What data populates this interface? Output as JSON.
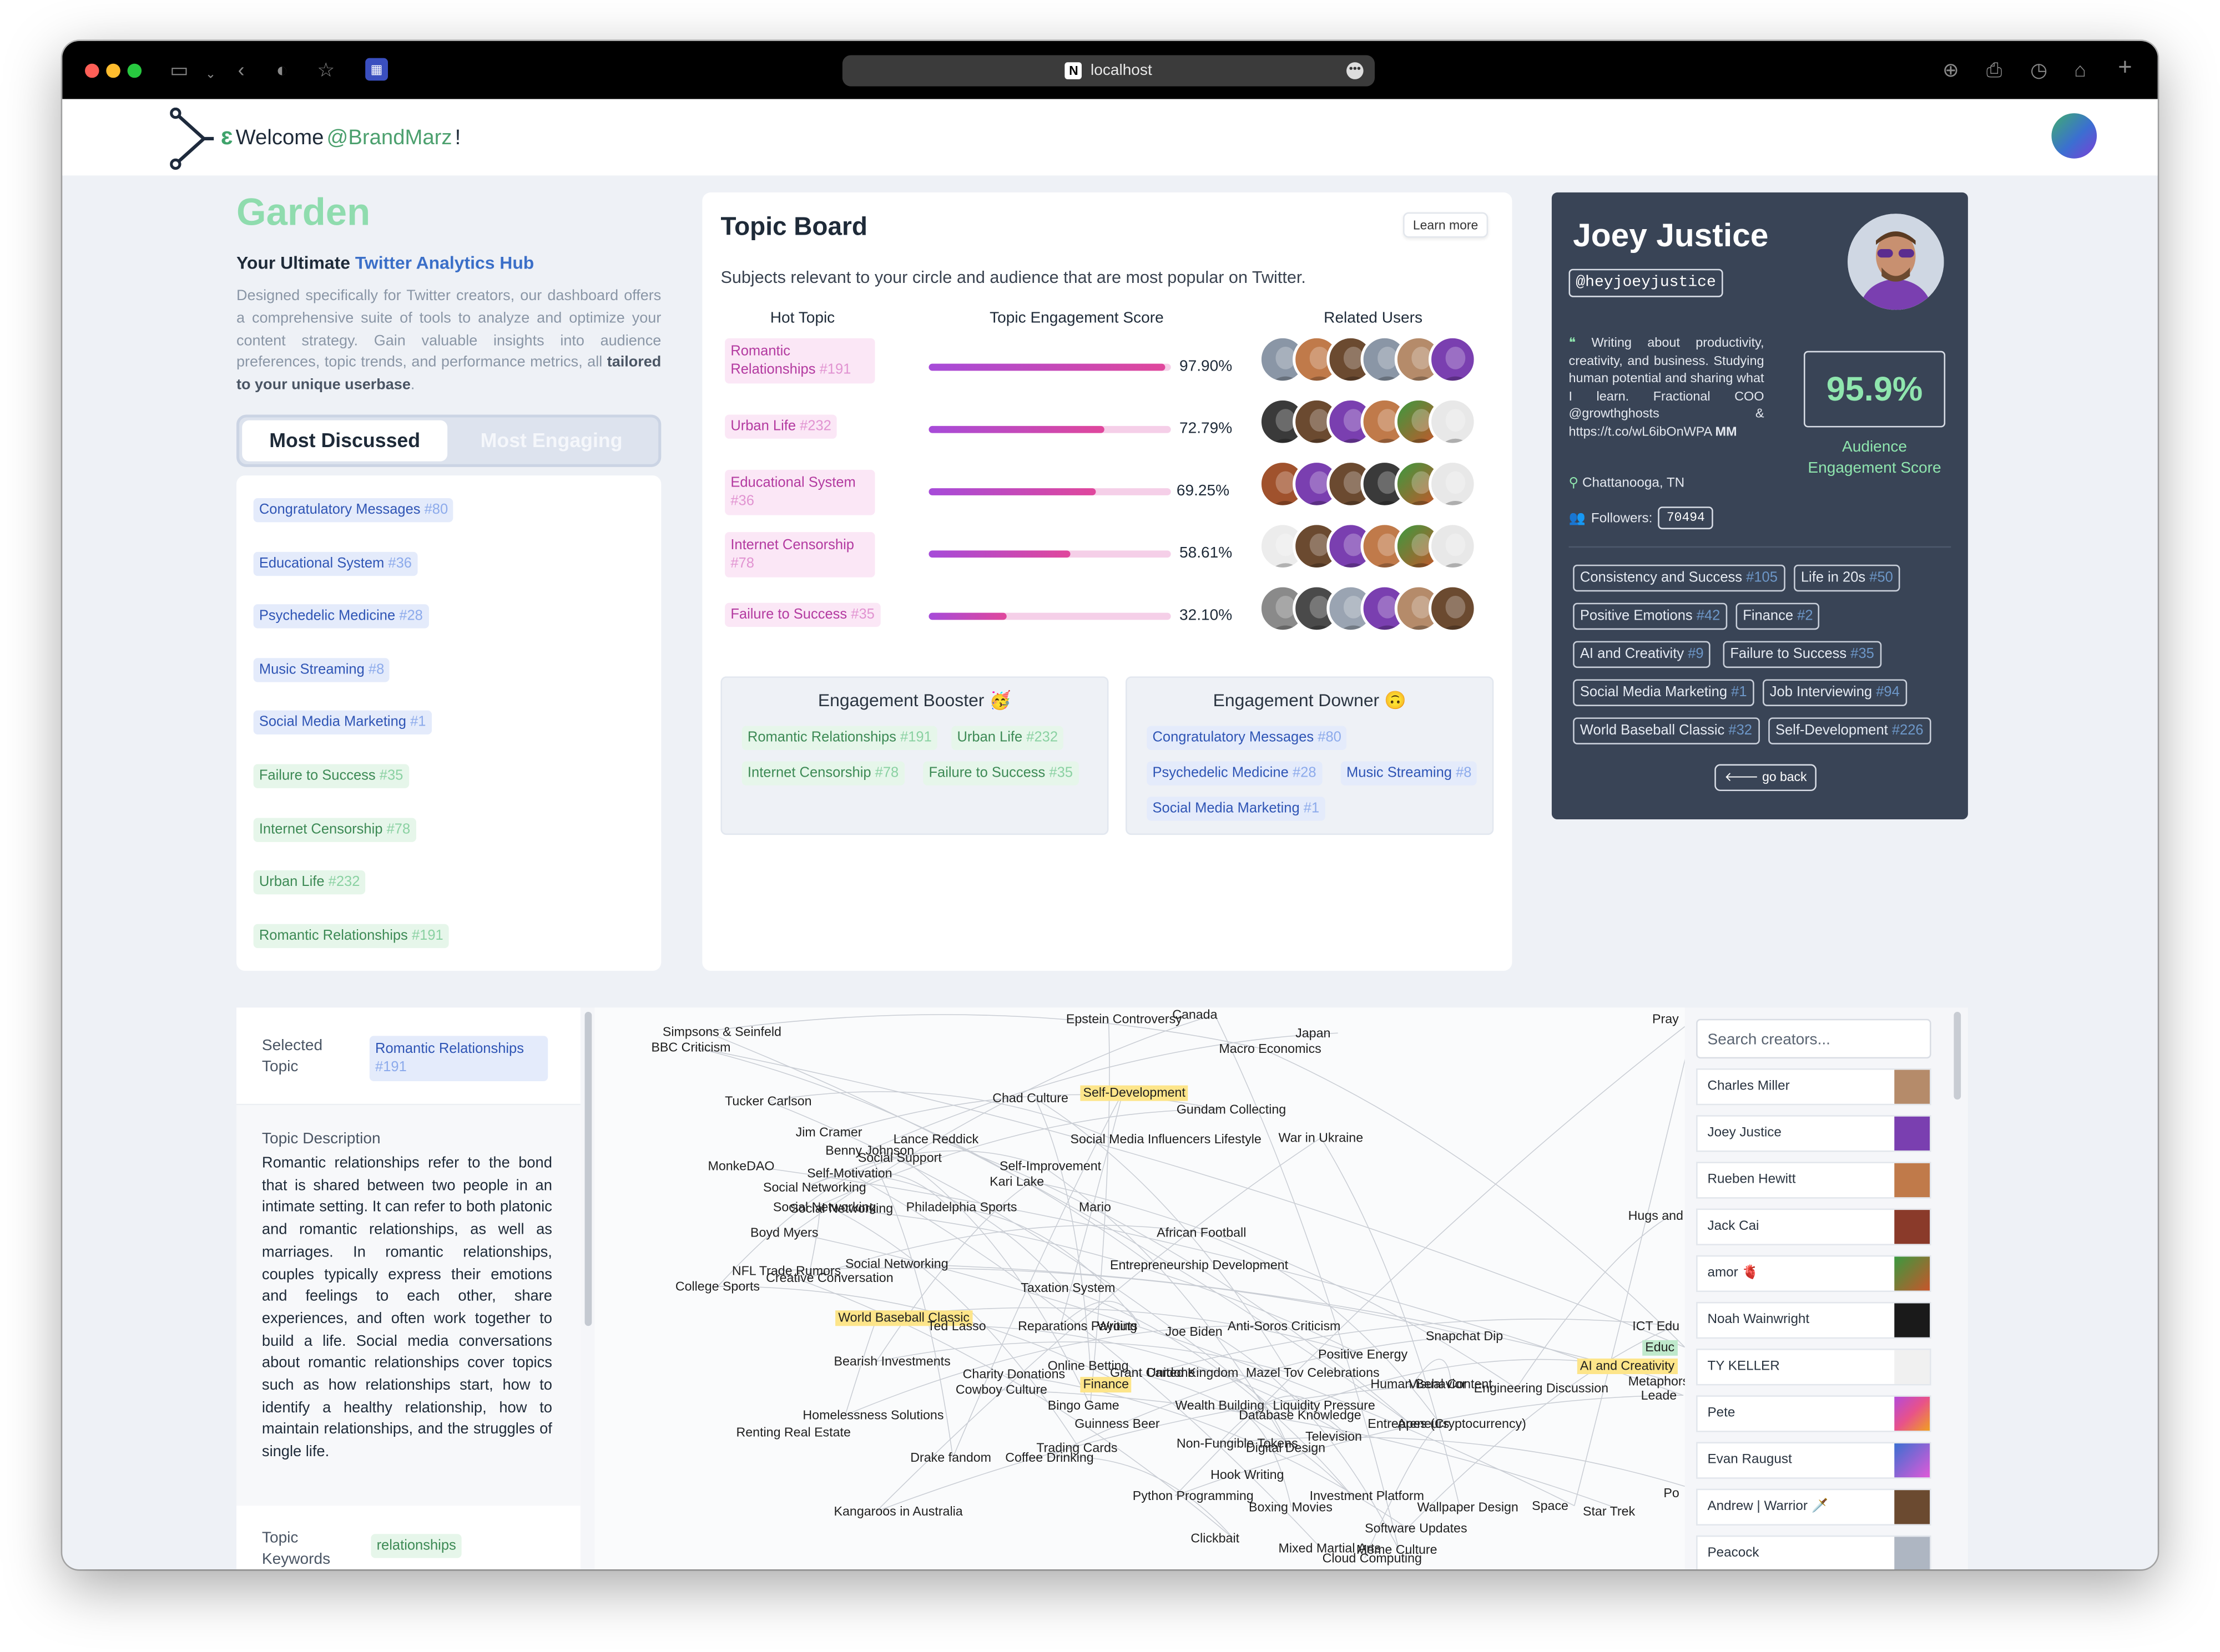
{
  "browser": {
    "url": "localhost"
  },
  "header": {
    "welcome": "Welcome ",
    "username": "@BrandMarz",
    "exclaim": "!"
  },
  "hero": {
    "brand": "Garden",
    "subtitle_prefix": "Your Ultimate ",
    "subtitle_highlight": "Twitter Analytics Hub",
    "description": "Designed specifically for Twitter creators, our dashboard offers a comprehensive suite of tools to analyze and optimize your content strategy. Gain valuable insights into audience preferences, topic trends, and performance metrics, all ",
    "description_bold": "tailored to your unique userbase",
    "description_end": "."
  },
  "tabs": {
    "active": "Most Discussed",
    "inactive": "Most Engaging"
  },
  "discussed": [
    {
      "label": "Congratulatory Messages",
      "num": "#80",
      "color": "blue"
    },
    {
      "label": "Educational System",
      "num": "#36",
      "color": "blue"
    },
    {
      "label": "Psychedelic Medicine",
      "num": "#28",
      "color": "blue"
    },
    {
      "label": "Music Streaming",
      "num": "#8",
      "color": "blue"
    },
    {
      "label": "Social Media Marketing",
      "num": "#1",
      "color": "blue"
    },
    {
      "label": "Failure to Success",
      "num": "#35",
      "color": "green"
    },
    {
      "label": "Internet Censorship",
      "num": "#78",
      "color": "green"
    },
    {
      "label": "Urban Life",
      "num": "#232",
      "color": "green"
    },
    {
      "label": "Romantic Relationships",
      "num": "#191",
      "color": "green"
    }
  ],
  "board": {
    "title": "Topic Board",
    "learn_more": "Learn more",
    "subtitle": "Subjects relevant to your circle and audience that are most popular on Twitter.",
    "col_topic": "Hot Topic",
    "col_score": "Topic Engagement Score",
    "col_users": "Related Users",
    "rows": [
      {
        "label": "Romantic Relationships",
        "num": "#191",
        "score": 0.979,
        "pct": "97.90%"
      },
      {
        "label": "Urban Life",
        "num": "#232",
        "score": 0.7279,
        "pct": "72.79%"
      },
      {
        "label": "Educational System",
        "num": "#36",
        "score": 0.6925,
        "pct": "69.25%"
      },
      {
        "label": "Internet Censorship",
        "num": "#78",
        "score": 0.5861,
        "pct": "58.61%"
      },
      {
        "label": "Failure to Success",
        "num": "#35",
        "score": 0.321,
        "pct": "32.10%"
      }
    ]
  },
  "booster": {
    "title": "Engagement Booster 🥳",
    "items": [
      {
        "label": "Romantic Relationships",
        "num": "#191"
      },
      {
        "label": "Urban Life",
        "num": "#232"
      },
      {
        "label": "Internet Censorship",
        "num": "#78"
      },
      {
        "label": "Failure to Success",
        "num": "#35"
      }
    ]
  },
  "downer": {
    "title": "Engagement Downer 🙃",
    "items": [
      {
        "label": "Congratulatory Messages",
        "num": "#80"
      },
      {
        "label": "Psychedelic Medicine",
        "num": "#28"
      },
      {
        "label": "Music Streaming",
        "num": "#8"
      },
      {
        "label": "Social Media Marketing",
        "num": "#1"
      }
    ]
  },
  "profile": {
    "name": "Joey Justice",
    "handle": "@heyjoeyjustice",
    "bio": "Writing about productivity, creativity, and business. Studying human potential and sharing what I learn. Fractional COO @growthghosts & https://t.co/wL6ibOnWPA ",
    "bio_bold": "MM",
    "location": "Chattanooga, TN",
    "followers_label": "Followers:",
    "followers": "70494",
    "score": "95.9%",
    "score_label": "Audience Engagement Score",
    "go_back": "go back",
    "topics": [
      {
        "label": "Consistency and Success",
        "num": "#105"
      },
      {
        "label": "Life in 20s",
        "num": "#50"
      },
      {
        "label": "Positive Emotions",
        "num": "#42"
      },
      {
        "label": "Finance",
        "num": "#2"
      },
      {
        "label": "AI and Creativity",
        "num": "#9"
      },
      {
        "label": "Failure to Success",
        "num": "#35"
      },
      {
        "label": "Social Media Marketing",
        "num": "#1"
      },
      {
        "label": "Job Interviewing",
        "num": "#94"
      },
      {
        "label": "World Baseball Classic",
        "num": "#32"
      },
      {
        "label": "Self-Development",
        "num": "#226"
      }
    ]
  },
  "selected": {
    "label": "Selected Topic",
    "topic": "Romantic Relationships",
    "num": "#191",
    "desc_label": "Topic Description",
    "description": "Romantic relationships refer to the bond that is shared between two people in an intimate setting. It can refer to both platonic and romantic relationships, as well as marriages. In romantic relationships, couples typically express their emotions and feelings to each other, share experiences, and often work together to build a life. Social media conversations about romantic relationships cover topics such as how relationships start, how to identify a healthy relationship, how to maintain relationships, and the struggles of single life.",
    "kw_label": "Topic Keywords",
    "keyword": "relationships"
  },
  "graph_nodes": [
    "Simpsons & Seinfeld",
    "BBC Criticism",
    "Epstein Controversy",
    "Canada",
    "Japan",
    "Macro Economics",
    "Pray",
    "Tucker Carlson",
    "Chad Culture",
    "Self-Development",
    "Gundam Collecting",
    "Jim Cramer",
    "Lance Reddick",
    "Benny Johnson",
    "Social Support",
    "MonkeDAO",
    "Self-Motivation",
    "Social Networking",
    "Social Media Influencers Lifestyle",
    "War in Ukraine",
    "Self-Improvement",
    "Kari Lake",
    "Social Networking",
    "Social Networking",
    "Philadelphia Sports",
    "Mario",
    "Boyd Myers",
    "African Football",
    "Social Networking",
    "NFL Trade Rumors",
    "Creative Conversation",
    "College Sports",
    "Entrepreneurship Development",
    "Taxation System",
    "World Baseball Classic",
    "Ted Lasso",
    "Reparations Payouts",
    "Writing",
    "Anti-Soros Criticism",
    "Joe Biden",
    "Snapchat Dip",
    "Hugs and",
    "ICT Edu",
    "Positive Energy",
    "Bearish Investments",
    "Online Betting",
    "Charity Donations",
    "Grant Cardone",
    "United Kingdom",
    "Mazel Tov Celebrations",
    "Finance",
    "AI and Creativity",
    "Educ",
    "Cowboy Culture",
    "Human Behavior",
    "Visual Content",
    "Engineering Discussion",
    "Metaphors a",
    "Leade",
    "Bingo Game",
    "Wealth Building",
    "Liquidity Pressure",
    "Database Knowledge",
    "Homelessness Solutions",
    "Guinness Beer",
    "Entrepreneurs",
    "Apes (Cryptocurrency)",
    "Renting Real Estate",
    "Non-Fungible Tokens",
    "Digital Design",
    "Television",
    "Trading Cards",
    "Drake fandom",
    "Coffee Drinking",
    "Hook Writing",
    "Python Programming",
    "Investment Platform",
    "Boxing Movies",
    "Wallpaper Design",
    "Space",
    "Star Trek",
    "Po",
    "Kangaroos in Australia",
    "Software Updates",
    "Clickbait",
    "Mixed Martial Arts",
    "Meme Culture",
    "Cloud Computing"
  ],
  "creators": {
    "placeholder": "Search creators...",
    "list": [
      "Charles Miller",
      "Joey Justice",
      "Rueben Hewitt",
      "Jack Cai",
      "amor 🫀",
      "Noah Wainwright",
      "TY KELLER",
      "Pete",
      "Evan Raugust",
      "Andrew | Warrior 🗡️",
      "Peacock"
    ]
  }
}
